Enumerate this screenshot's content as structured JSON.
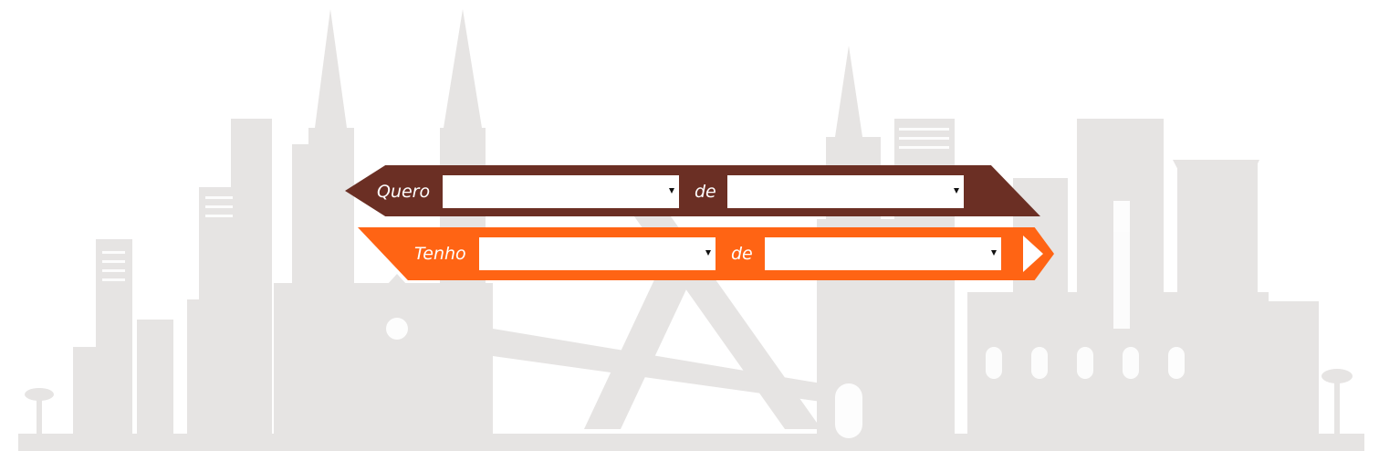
{
  "colors": {
    "top_band": "#6b2f24",
    "bottom_band": "#ff6414",
    "skyline": "#e3e1e0",
    "skyline_light": "#ebe9e8"
  },
  "want_row": {
    "label": "Quero",
    "of_label": "de",
    "select_1_value": "",
    "select_2_value": ""
  },
  "have_row": {
    "label": "Tenho",
    "of_label": "de",
    "select_1_value": "",
    "select_2_value": ""
  },
  "icons": [
    "chevron-down-icon",
    "arrow-right-icon",
    "city-skyline-illustration"
  ]
}
